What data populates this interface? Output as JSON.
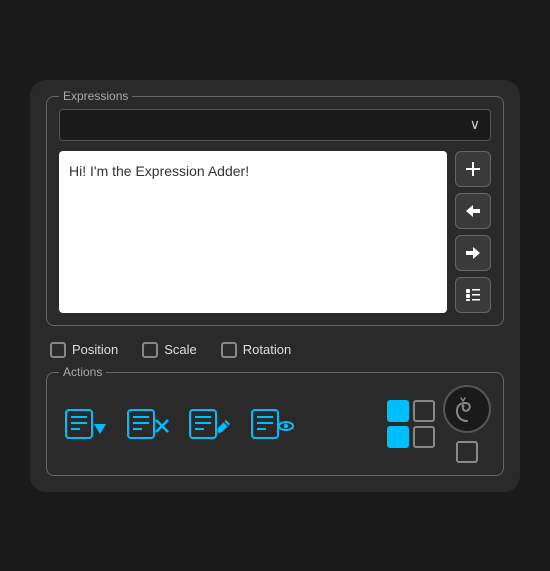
{
  "panel": {
    "expressions_label": "Expressions",
    "actions_label": "Actions",
    "dropdown_chevron": "∨",
    "text_content": "Hi! I'm the Expression Adder!",
    "checkboxes": [
      {
        "id": "position",
        "label": "Position",
        "checked": false
      },
      {
        "id": "scale",
        "label": "Scale",
        "checked": false
      },
      {
        "id": "rotation",
        "label": "Rotation",
        "checked": false
      }
    ],
    "side_buttons": [
      {
        "id": "add",
        "symbol": "＋"
      },
      {
        "id": "import",
        "symbol": "↩"
      },
      {
        "id": "export",
        "symbol": "↪"
      },
      {
        "id": "list",
        "symbol": "≡"
      }
    ],
    "action_buttons": [
      {
        "id": "append",
        "label": "append-action"
      },
      {
        "id": "delete",
        "label": "delete-action"
      },
      {
        "id": "edit",
        "label": "edit-action"
      },
      {
        "id": "view",
        "label": "view-action"
      }
    ],
    "mini_grid": [
      {
        "active": true
      },
      {
        "active": false
      },
      {
        "active": true
      },
      {
        "active": false
      }
    ],
    "colors": {
      "accent": "#00bfff",
      "border": "#666666",
      "bg_dark": "#1a1a1a",
      "bg_panel": "#2a2a2a"
    }
  }
}
